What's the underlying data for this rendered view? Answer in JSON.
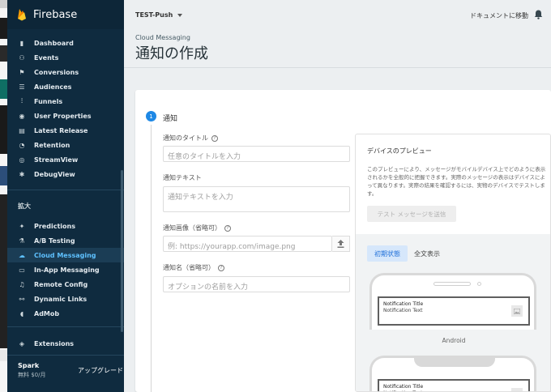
{
  "sidebar": {
    "brand": "Firebase",
    "items_analytics": [
      {
        "label": "Dashboard",
        "icon": "dashboard-icon"
      },
      {
        "label": "Events",
        "icon": "events-icon"
      },
      {
        "label": "Conversions",
        "icon": "flag-icon"
      },
      {
        "label": "Audiences",
        "icon": "audiences-icon"
      },
      {
        "label": "Funnels",
        "icon": "funnels-icon"
      },
      {
        "label": "User Properties",
        "icon": "user-properties-icon"
      },
      {
        "label": "Latest Release",
        "icon": "latest-release-icon"
      },
      {
        "label": "Retention",
        "icon": "retention-icon"
      },
      {
        "label": "StreamView",
        "icon": "streamview-icon"
      },
      {
        "label": "DebugView",
        "icon": "debugview-icon"
      }
    ],
    "section_grow": "拡大",
    "items_grow": [
      {
        "label": "Predictions",
        "icon": "predictions-icon"
      },
      {
        "label": "A/B Testing",
        "icon": "ab-testing-icon"
      },
      {
        "label": "Cloud Messaging",
        "icon": "cloud-messaging-icon"
      },
      {
        "label": "In-App Messaging",
        "icon": "in-app-messaging-icon"
      },
      {
        "label": "Remote Config",
        "icon": "remote-config-icon"
      },
      {
        "label": "Dynamic Links",
        "icon": "dynamic-links-icon"
      },
      {
        "label": "AdMob",
        "icon": "admob-icon"
      }
    ],
    "extensions": "Extensions",
    "plan_name": "Spark",
    "plan_price": "無料 $0/月",
    "upgrade": "アップグレード"
  },
  "topbar": {
    "project": "TEST-Push",
    "docs_link": "ドキュメントに移動"
  },
  "header": {
    "breadcrumb": "Cloud Messaging",
    "title": "通知の作成"
  },
  "form": {
    "step_number": "1",
    "step_title": "通知",
    "title_label": "通知のタイトル",
    "title_placeholder": "任意のタイトルを入力",
    "text_label": "通知テキスト",
    "text_placeholder": "通知テキストを入力",
    "image_label": "通知画像（省略可）",
    "image_placeholder": "例: https://yourapp.com/image.png",
    "name_label": "通知名（省略可）",
    "name_placeholder": "オプションの名前を入力"
  },
  "preview": {
    "title": "デバイスのプレビュー",
    "description": "このプレビューにより、メッセージがモバイルデバイス上でどのように表示されるかを全般的に把握できます。実際のメッセージの表示はデバイスによって異なります。実際の結果を確認するには、実物のデバイスでテストします。",
    "test_button": "テスト メッセージを送信",
    "tab_initial": "初期状態",
    "tab_full": "全文表示",
    "notification_title": "Notification Title",
    "notification_text": "Notification Text",
    "android_label": "Android"
  },
  "colors": {
    "sidebar_bg": "#0f2b3f",
    "active_text": "#5ec1ff",
    "accent": "#1e88e5"
  }
}
